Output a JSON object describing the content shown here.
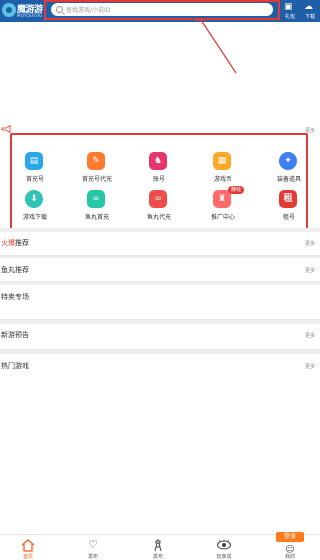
{
  "header": {
    "logo_text": "魔游游",
    "logo_sub": "MOYOUYOU",
    "search_placeholder": "查找游戏/小说ID",
    "gift_label": "礼包",
    "download_label": "下载"
  },
  "notice": {
    "more": "更多"
  },
  "categories": [
    {
      "label": "首充号",
      "icon": "ticket-icon",
      "color": "#2aa7e8",
      "glyph": "▤"
    },
    {
      "label": "首充号代充",
      "icon": "voucher-icon",
      "color": "#ff7a2f",
      "glyph": "✎"
    },
    {
      "label": "账号",
      "icon": "account-icon",
      "color": "#e8356b",
      "glyph": "♞"
    },
    {
      "label": "游戏币",
      "icon": "coin-icon",
      "color": "#ffa726",
      "glyph": "▦"
    },
    {
      "label": "装备道具",
      "icon": "equipment-icon",
      "color": "#3d7ff5",
      "glyph": "✦"
    },
    {
      "label": "游戏下载",
      "icon": "download-icon",
      "color": "#2ec4b6",
      "glyph": "⬇"
    },
    {
      "label": "鱼丸首充",
      "icon": "fishball-icon",
      "color": "#26c6a6",
      "glyph": "∞"
    },
    {
      "label": "鱼丸代充",
      "icon": "fishball-recharge-icon",
      "color": "#ef4c4c",
      "glyph": "∞"
    },
    {
      "label": "推广中心",
      "icon": "promo-icon",
      "color": "#ff6b6b",
      "glyph": "♜",
      "badge": "赚钱"
    },
    {
      "label": "租号",
      "icon": "rent-icon",
      "color": "#e53935",
      "glyph": "租"
    }
  ],
  "sections": [
    {
      "title_hl": "火爆",
      "title_rest": "推荐",
      "more": "更多"
    },
    {
      "title_hl": "",
      "title_rest": "鱼丸推荐",
      "more": "更多"
    },
    {
      "title_hl": "",
      "title_rest": "特卖专场",
      "more": ""
    },
    {
      "title_hl": "",
      "title_rest": "新游预告",
      "more": "更多"
    },
    {
      "title_hl": "",
      "title_rest": "热门游戏",
      "more": "更多"
    }
  ],
  "tabs": [
    {
      "label": "首页",
      "icon": "home-icon",
      "glyph": "⌂"
    },
    {
      "label": "发布",
      "icon": "heart-icon",
      "glyph": "♡"
    },
    {
      "label": "发布",
      "icon": "tower-icon",
      "glyph": "♗"
    },
    {
      "label": "玩家说",
      "icon": "eye-icon",
      "glyph": "◉"
    },
    {
      "label": "我的",
      "icon": "profile-icon",
      "glyph": "☺",
      "badge": "登录"
    }
  ]
}
